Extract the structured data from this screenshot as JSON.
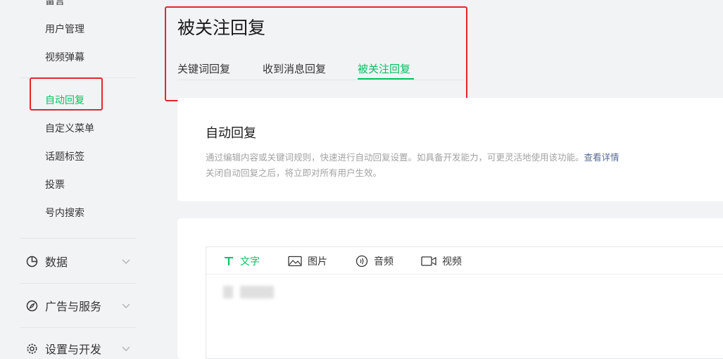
{
  "sidebar": {
    "partial_top_label": "留言",
    "sub_items": [
      "用户管理",
      "视频弹幕",
      "自动回复",
      "自定义菜单",
      "话题标签",
      "投票",
      "号内搜索"
    ],
    "active_sub_item": "自动回复",
    "groups": [
      {
        "label": "数据",
        "icon": "pie-chart-icon"
      },
      {
        "label": "广告与服务",
        "icon": "compass-icon"
      },
      {
        "label": "设置与开发",
        "icon": "gear-icon"
      }
    ]
  },
  "header": {
    "title": "被关注回复",
    "tabs": [
      {
        "label": "关键词回复"
      },
      {
        "label": "收到消息回复"
      },
      {
        "label": "被关注回复"
      }
    ],
    "active_tab": "被关注回复"
  },
  "info_card": {
    "title": "自动回复",
    "desc_line1": "通过编辑内容或关键词规则，快速进行自动回复设置。如具备开发能力，可更灵活地使用该功能。",
    "desc_link": "查看详情",
    "desc_line2": "关闭自动回复之后，将立即对所有用户生效。"
  },
  "editor": {
    "tools": [
      {
        "label": "文字",
        "icon": "text-icon"
      },
      {
        "label": "图片",
        "icon": "image-icon"
      },
      {
        "label": "音频",
        "icon": "audio-icon"
      },
      {
        "label": "视频",
        "icon": "video-icon"
      }
    ],
    "active_tool": "文字"
  },
  "colors": {
    "accent": "#07c160",
    "highlight_border": "#e8262b",
    "link": "#576b95"
  }
}
